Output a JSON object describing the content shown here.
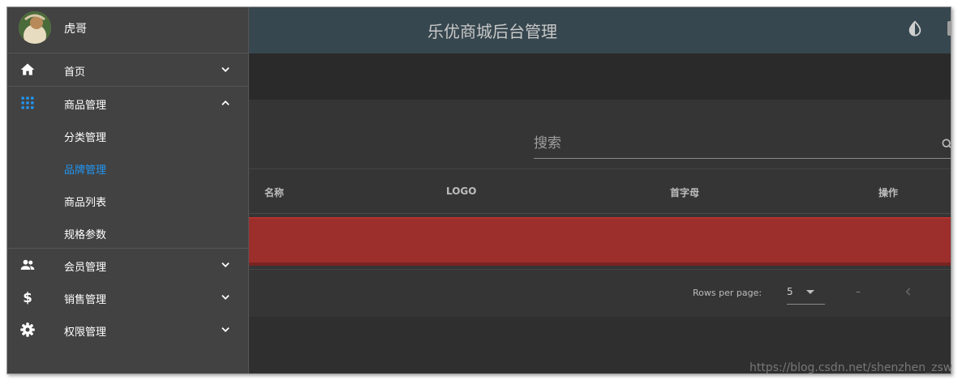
{
  "app": {
    "title": "乐优商城后台管理"
  },
  "user": {
    "name": "虎哥"
  },
  "nav": {
    "items": [
      {
        "label": "首页",
        "icon": "home-icon",
        "expanded": false
      },
      {
        "label": "商品管理",
        "icon": "apps-grid-icon",
        "expanded": true,
        "children": [
          {
            "label": "分类管理",
            "active": false
          },
          {
            "label": "品牌管理",
            "active": true
          },
          {
            "label": "商品列表",
            "active": false
          },
          {
            "label": "规格参数",
            "active": false
          }
        ]
      },
      {
        "label": "会员管理",
        "icon": "people-icon",
        "expanded": false
      },
      {
        "label": "销售管理",
        "icon": "dollar-icon",
        "expanded": false
      },
      {
        "label": "权限管理",
        "icon": "gear-icon",
        "expanded": false
      }
    ]
  },
  "search": {
    "placeholder": "搜索"
  },
  "table": {
    "columns": [
      "名称",
      "LOGO",
      "首字母",
      "操作"
    ]
  },
  "pagination": {
    "rows_label": "Rows per page:",
    "rows_value": "5",
    "range": "–"
  },
  "colors": {
    "appbar": "#37474f",
    "drawer": "#424242",
    "active": "#2196f3",
    "error_row": "#9c2e2b"
  },
  "watermark": "https://blog.csdn.net/shenzhen_zsw"
}
